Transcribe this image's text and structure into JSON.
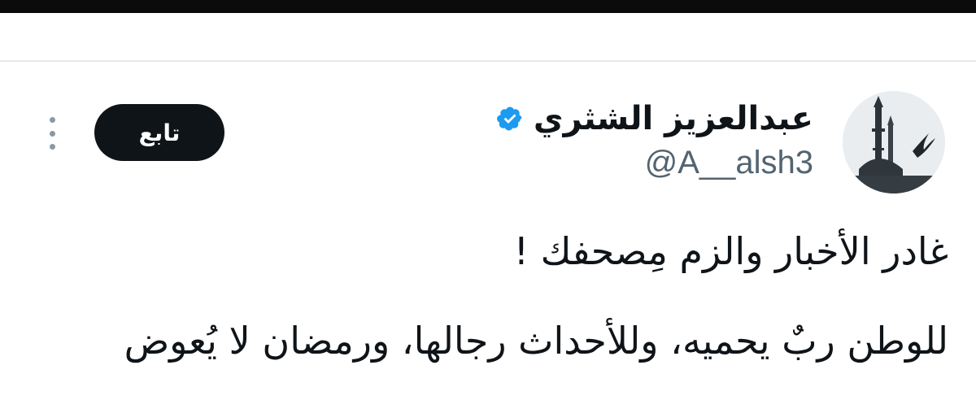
{
  "tweet": {
    "author": {
      "display_name": "عبدالعزيز الشثري",
      "handle": "@A__alsh3",
      "verified": true,
      "avatar_icon": "mosque-silhouette-avatar"
    },
    "follow_label": "تابع",
    "more_icon": "more-vertical-icon",
    "body": {
      "line1": "غادر الأخبار  والزم مِصحفك !",
      "line2": "للوطن ربٌ يحميه، وللأحداث رجالها، ورمضان لا يُعوض"
    }
  },
  "colors": {
    "text_primary": "#0f1419",
    "text_secondary": "#536471",
    "verified_blue": "#1d9bf0",
    "follow_bg": "#0f1419",
    "follow_text": "#ffffff",
    "top_bar": "#0b0b0b"
  }
}
